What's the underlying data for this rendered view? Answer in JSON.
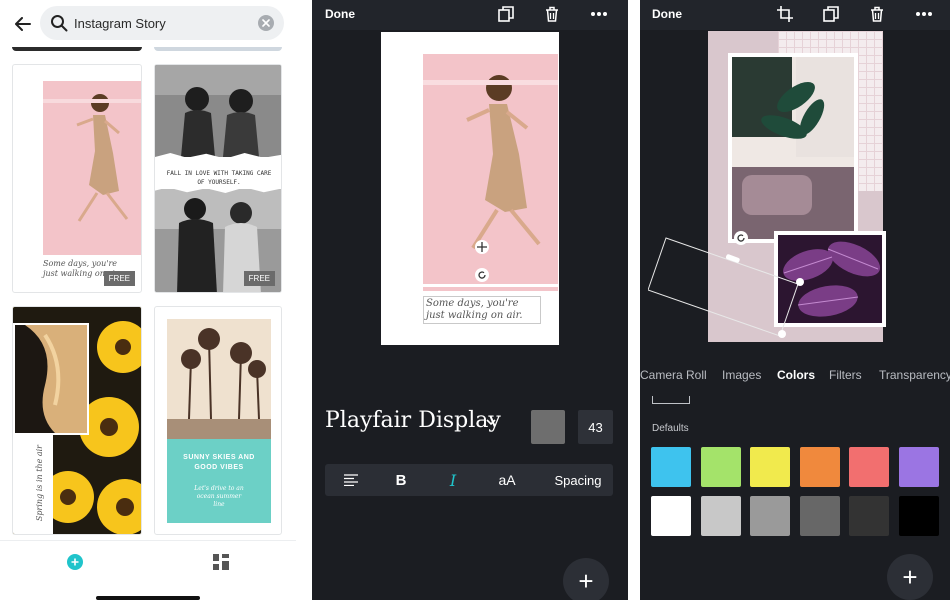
{
  "left_panel": {
    "search": {
      "value": "Instagram Story"
    },
    "templates": [
      {
        "caption": "Some days, you're just walking on air.",
        "badge": "FREE"
      },
      {
        "caption": "FALL IN LOVE WITH TAKING CARE OF YOURSELF.",
        "badge": "FREE"
      },
      {
        "caption": "Spring is in the air"
      },
      {
        "caption": "SUNNY SKIES AND GOOD VIBES",
        "subcaption": "Let's drive to an ocean summer line"
      }
    ]
  },
  "text_editor": {
    "done_label": "Done",
    "canvas_text": "Some days, you're just walking on air.",
    "font_name": "Playfair Display",
    "font_size": "43",
    "text_color": "#6e6e6e",
    "format": {
      "bold": "B",
      "italic": "I",
      "case": "aA",
      "spacing": "Spacing"
    },
    "fab_label": "+"
  },
  "colors_panel": {
    "done_label": "Done",
    "tabs": [
      "Camera Roll",
      "Images",
      "Colors",
      "Filters",
      "Transparency"
    ],
    "active_tab": "Colors",
    "section_label": "Defaults",
    "colors": [
      "#3ec3ee",
      "#a4e36a",
      "#f1ea4d",
      "#f0893d",
      "#f26f6f",
      "#9b75e3",
      "#ffffff",
      "#c8c8c8",
      "#9a9a9a",
      "#676767",
      "#333333",
      "#000000"
    ],
    "fab_label": "+"
  }
}
